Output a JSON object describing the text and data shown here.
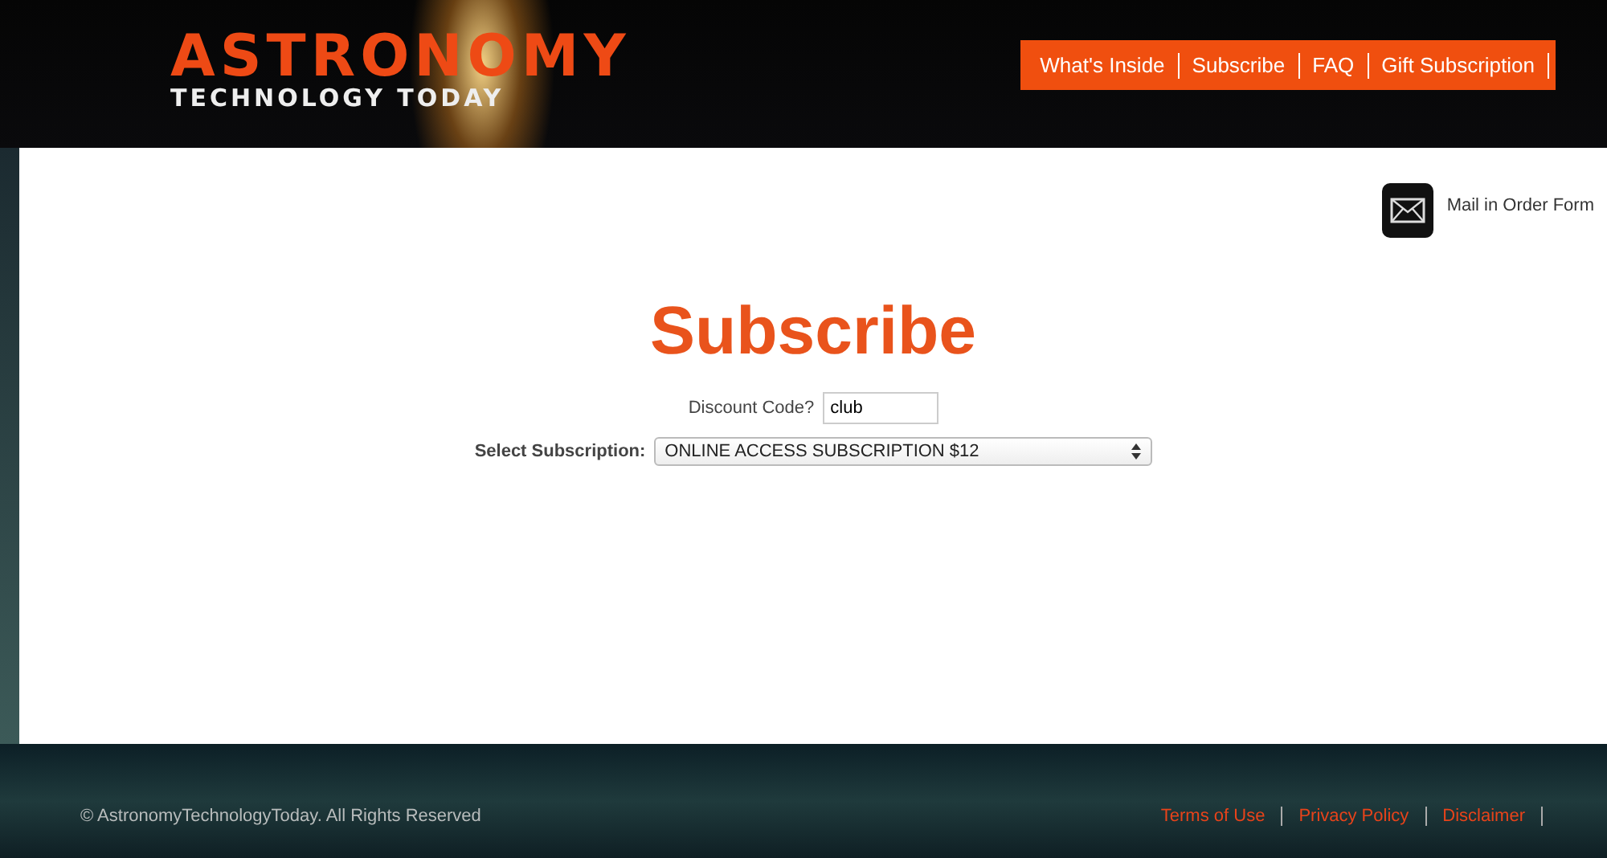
{
  "header": {
    "logo_top": "ASTRONOMY",
    "logo_bottom": "TECHNOLOGY TODAY",
    "nav": [
      {
        "label": "What's Inside"
      },
      {
        "label": "Subscribe"
      },
      {
        "label": "FAQ"
      },
      {
        "label": "Gift Subscription"
      }
    ]
  },
  "mail_link": "Mail in Order Form",
  "heading": "Subscribe",
  "discount": {
    "label": "Discount Code?",
    "value": "club"
  },
  "subscription": {
    "label": "Select Subscription:",
    "value": "ONLINE ACCESS SUBSCRIPTION $12"
  },
  "footer": {
    "copyright": "© AstronomyTechnologyToday. All Rights Reserved",
    "links": [
      {
        "label": "Terms of Use"
      },
      {
        "label": "Privacy Policy"
      },
      {
        "label": "Disclaimer"
      }
    ]
  }
}
